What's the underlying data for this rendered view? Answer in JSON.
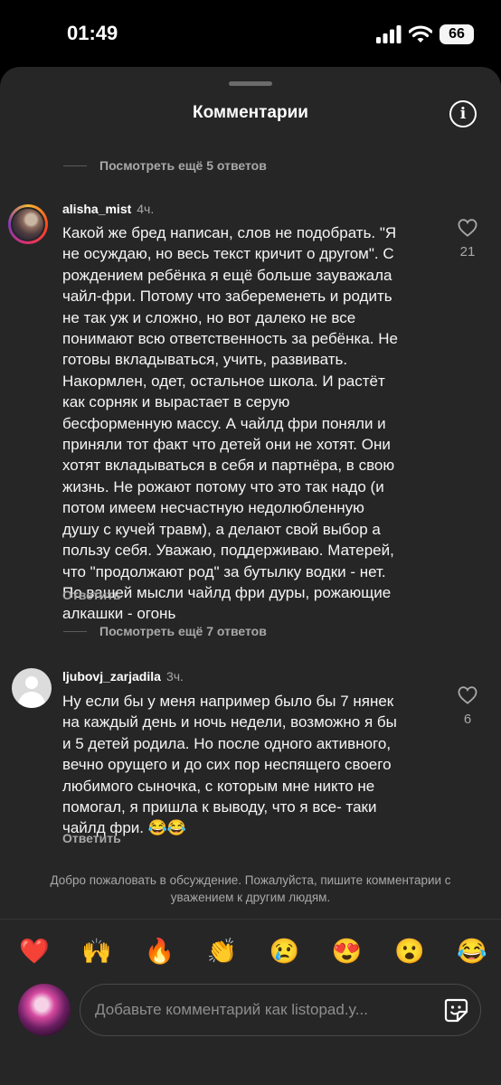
{
  "status": {
    "time": "01:49",
    "battery": "66"
  },
  "sheet": {
    "title": "Комментарии"
  },
  "threads": [
    {
      "view_more": "Посмотреть ещё 5 ответов"
    },
    {
      "view_more": "Посмотреть ещё 7 ответов"
    }
  ],
  "comments": [
    {
      "username": "alisha_mist",
      "time": "4ч.",
      "text": "Какой же бред написан, слов не подобрать. \"Я\nне осуждаю, но весь текст кричит о другом\". С\nрождением ребёнка я ещё больше зауважала\nчайл-фри. Потому что забеременеть и родить\nне так уж и сложно, но вот далеко не все\nпонимают всю ответственность за ребёнка. Не\nготовы вкладываться, учить, развивать.\nНакормлен, одет, остальное школа. И растёт\nкак сорняк и вырастает в серую\nбесформенную массу. А чайлд фри поняли и\nприняли тот факт что детей они не хотят. Они\nхотят вкладываться в себя и партнёра, в свою\nжизнь. Не рожают потому что это так надо (и\nпотом имеем несчастную недолюбленную\nдушу с кучей травм), а делают свой выбор а\nпользу себя. Уважаю, поддерживаю. Матерей,\nчто \"продолжают род\" за бутылку водки -  нет.\nПо вашей мысли чайлд фри дуры, рожающие\nалкашки - огонь",
      "likes": "21",
      "reply_label": "Ответить"
    },
    {
      "username": "ljubovj_zarjadila",
      "time": "3ч.",
      "text": "Ну если бы у меня например было бы 7 нянек\nна каждый день и ночь недели, возможно я бы\nи 5 детей родила. Но после одного активного,\nвечно орущего и до сих пор неспящего своего\nлюбимого сыночка, с которым мне никто не\nпомогал, я пришла к выводу, что я все- таки\nчайлд фри. 😂😂",
      "likes": "6",
      "reply_label": "Ответить"
    }
  ],
  "guidelines": "Добро пожаловать в обсуждение. Пожалуйста, пишите комментарии с уважением к другим людям.",
  "emoji_bar": [
    "❤️",
    "🙌",
    "🔥",
    "👏",
    "😢",
    "😍",
    "😮",
    "😂"
  ],
  "composer": {
    "placeholder": "Добавьте комментарий как listopad.y..."
  }
}
